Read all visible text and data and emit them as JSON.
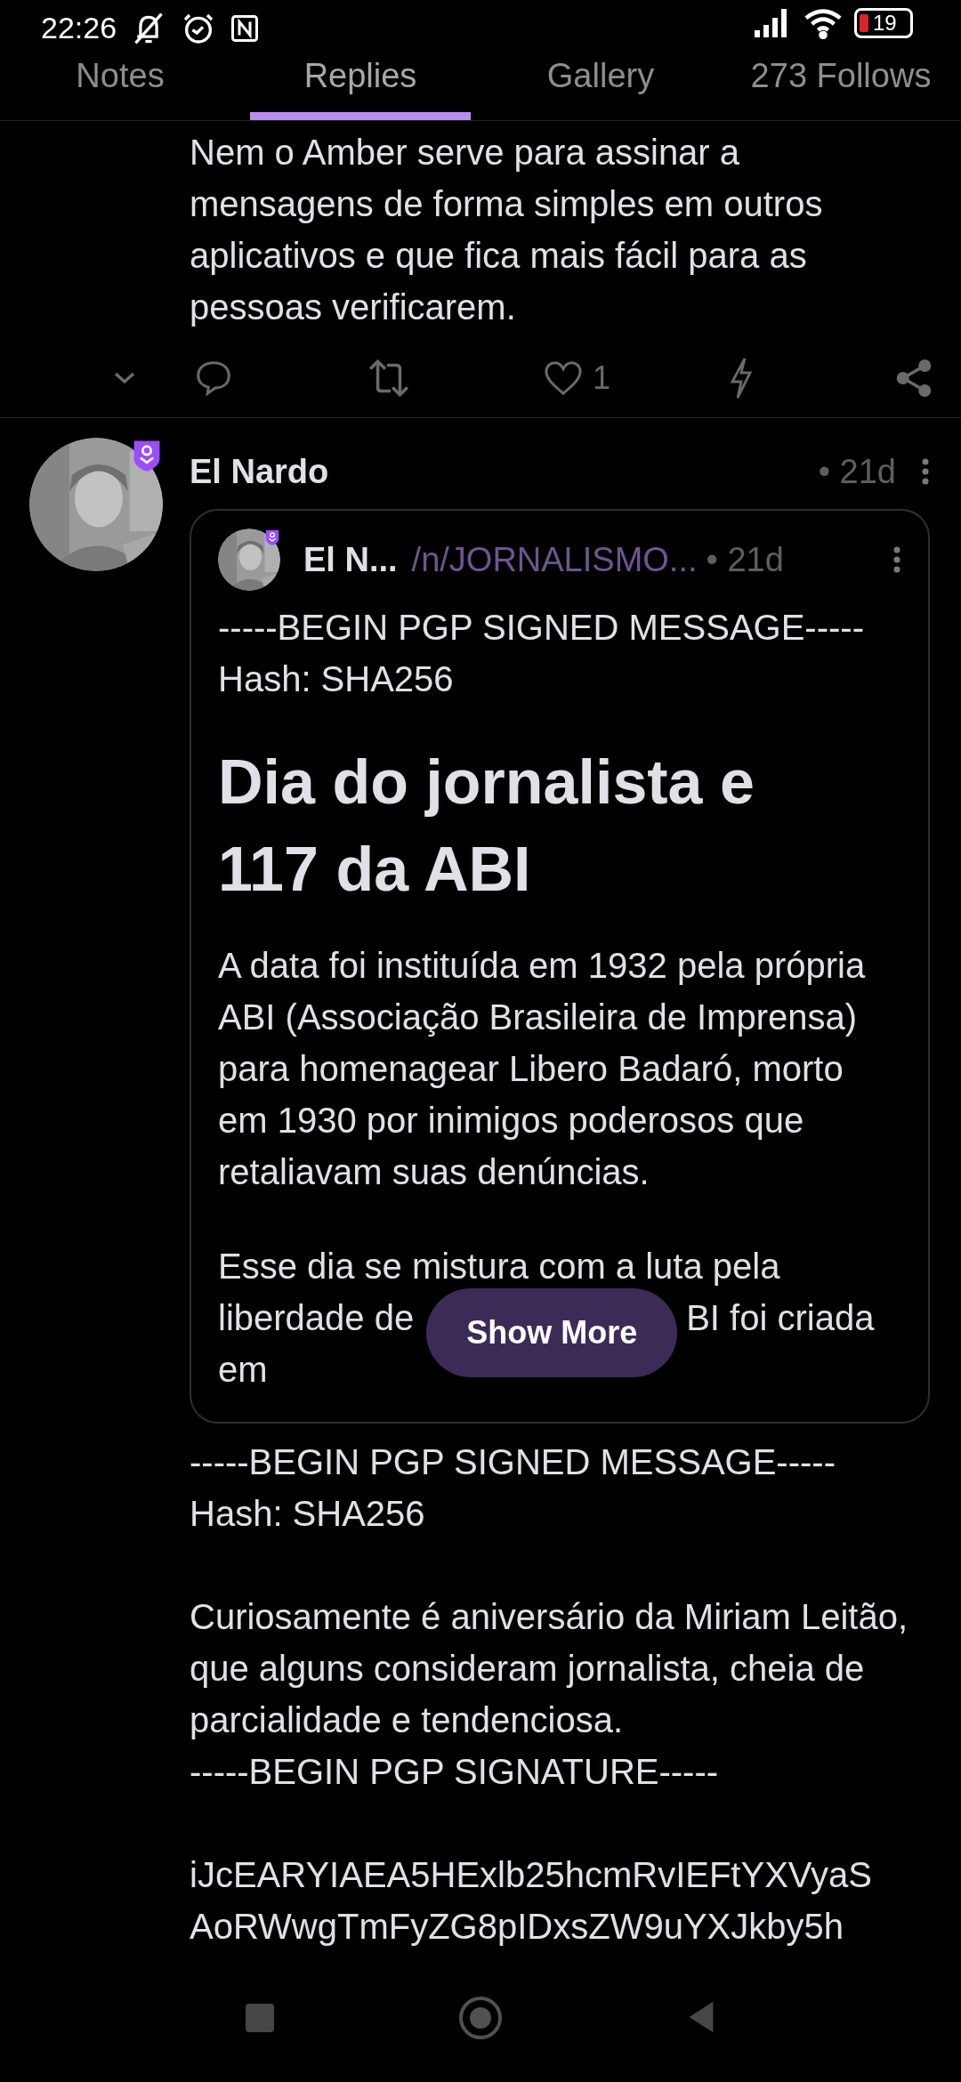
{
  "status_bar": {
    "time": "22:26",
    "battery": "19"
  },
  "tabs": [
    {
      "label": "Notes",
      "selected": false
    },
    {
      "label": "Replies",
      "selected": true
    },
    {
      "label": "Gallery",
      "selected": false
    },
    {
      "label": "273 Follows",
      "selected": false
    }
  ],
  "reply": {
    "text": "Nem o Amber serve para assinar a mensagens de forma simples em outros aplicativos e que fica mais fácil para as pessoas verificarem.",
    "likes": "1"
  },
  "post": {
    "author": "El Nardo",
    "time": "• 21d",
    "quote": {
      "author": "El N...",
      "community": "/n/JORNALISMO...",
      "time": "• 21d",
      "header_lines": [
        "-----BEGIN PGP SIGNED MESSAGE-----",
        "Hash: SHA256"
      ],
      "title": "Dia do jornalista e 117 da ABI",
      "paragraph": "A data foi instituída em 1932 pela própria ABI (Associação Brasileira de Imprensa) para homenagear Libero Badaró, morto em 1930 por inimigos poderosos que retaliavam suas denúncias.",
      "cut_paragraph": {
        "line_1": "Esse dia se mistura com a luta pela",
        "line_2_left": "liberdade de",
        "line_2_right": "BI foi criada",
        "line_3": "em"
      },
      "show_more": "Show More"
    },
    "body": [
      [
        "-----BEGIN PGP SIGNED MESSAGE-----",
        "Hash: SHA256"
      ],
      [
        "Curiosamente é aniversário da Miriam Leitão, que alguns consideram jornalista, cheia de parcialidade e tendenciosa.",
        "-----BEGIN PGP SIGNATURE-----"
      ],
      [
        "iJcEARYIAEA5HExlb25hcmRvIEFtYXVyaS",
        "AoRWwgTmFyZG8pIDxsZW9uYXJkby5h"
      ]
    ]
  }
}
